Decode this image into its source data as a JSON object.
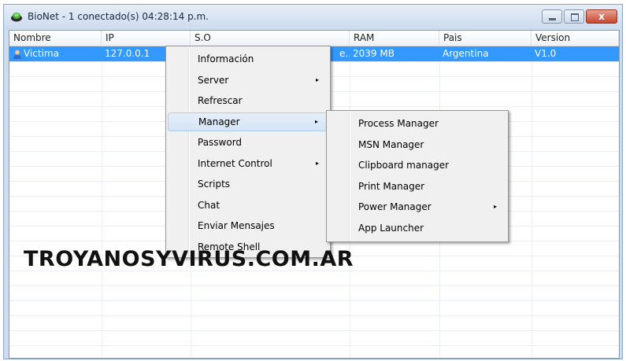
{
  "window": {
    "title": "BioNet - 1 conectado(s)   04:28:14 p.m.",
    "close_glyph": "x"
  },
  "table": {
    "columns": [
      "Nombre",
      "IP",
      "S.O",
      "RAM",
      "Pais",
      "Version"
    ],
    "rows": [
      {
        "nombre": "Victima",
        "ip": "127.0.0.1",
        "so_tail": "e...",
        "ram": "2039 MB",
        "pais": "Argentina",
        "version": "V1.0",
        "selected": true
      }
    ]
  },
  "context_menu": {
    "items": [
      {
        "label": "Información",
        "submenu": false
      },
      {
        "label": "Server",
        "submenu": true
      },
      {
        "label": "Refrescar",
        "submenu": false
      },
      {
        "label": "Manager",
        "submenu": true,
        "highlighted": true
      },
      {
        "label": "Password",
        "submenu": false
      },
      {
        "label": "Internet Control",
        "submenu": true
      },
      {
        "label": "Scripts",
        "submenu": false
      },
      {
        "label": "Chat",
        "submenu": false
      },
      {
        "label": "Enviar Mensajes",
        "submenu": false
      },
      {
        "label": "Remote Shell",
        "submenu": false
      }
    ]
  },
  "submenu_manager": {
    "items": [
      {
        "label": "Process Manager",
        "submenu": false
      },
      {
        "label": "MSN Manager",
        "submenu": false
      },
      {
        "label": "Clipboard manager",
        "submenu": false
      },
      {
        "label": "Print Manager",
        "submenu": false
      },
      {
        "label": "Power Manager",
        "submenu": true
      },
      {
        "label": "App Launcher",
        "submenu": false
      }
    ]
  },
  "watermark": "TROYANOSYVIRUS.COM.AR",
  "icons": {
    "app": "bionet-app-icon",
    "user": "user-icon",
    "submenu_arrow": "▸"
  },
  "colors": {
    "selection": "#3399ff",
    "menu_bg": "#f0f0f0",
    "close_button": "#c7452e"
  }
}
